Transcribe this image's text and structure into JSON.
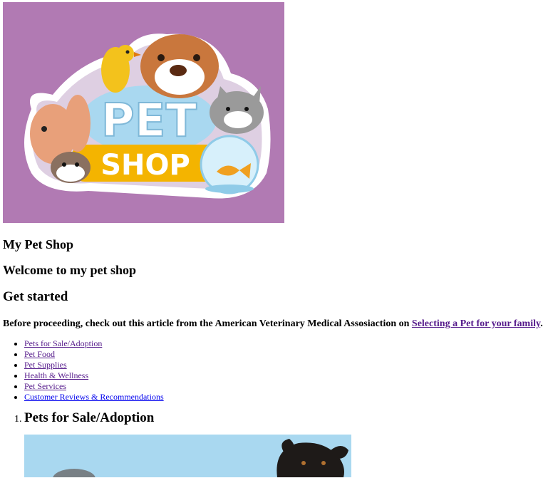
{
  "logo": {
    "line1": "PET",
    "line2": "SHOP",
    "colors": {
      "background": "#b17ab3",
      "sign_yellow": "#f4b400",
      "sign_blue": "#a9d8f0",
      "dog_brown": "#c9773d",
      "bird_yellow": "#f3c21c"
    }
  },
  "site_title": "My Pet Shop",
  "welcome": "Welcome to my pet shop",
  "get_started": "Get started",
  "intro": {
    "text": "Before proceeding, check out this article from the American Veterinary Medical Assosiaction on ",
    "link": "Selecting a Pet for your family",
    "suffix": "."
  },
  "menu": [
    {
      "label": "Pets for Sale/Adoption"
    },
    {
      "label": "Pet Food"
    },
    {
      "label": "Pet Supplies"
    },
    {
      "label": "Health & Wellness"
    },
    {
      "label": "Pet Services"
    },
    {
      "label": "Customer Reviews & Recommendations"
    }
  ],
  "sections": [
    {
      "title": "Pets for Sale/Adoption"
    }
  ]
}
